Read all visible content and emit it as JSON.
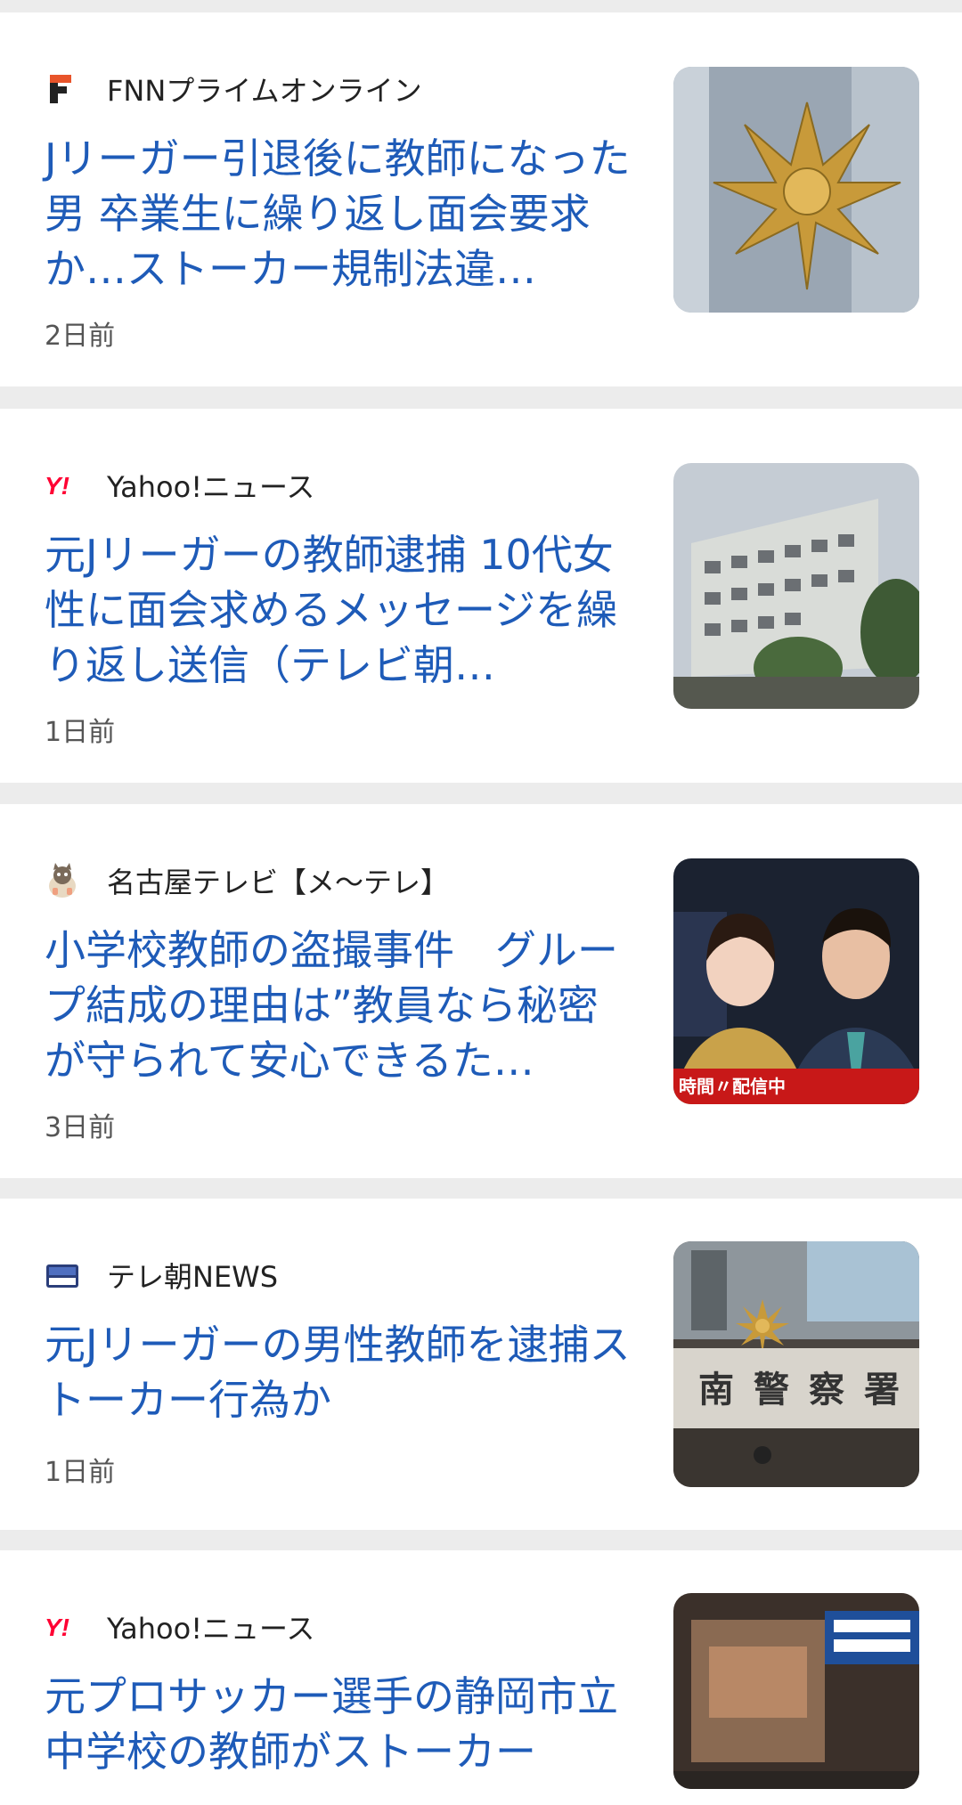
{
  "articles": [
    {
      "source": "FNNプライムオンライン",
      "source_icon": "fnn-logo-icon",
      "title": "Jリーガー引退後に教師になった男 卒業生に繰り返し面会要求か…ストーカー規制法違…",
      "time": "2日前",
      "thumbnail": "police-emblem-thumbnail"
    },
    {
      "source": "Yahoo!ニュース",
      "source_icon": "yahoo-logo-icon",
      "title": "元Jリーガーの教師逮捕 10代女性に面会求めるメッセージを繰り返し送信（テレビ朝…",
      "time": "1日前",
      "thumbnail": "police-building-thumbnail"
    },
    {
      "source": "名古屋テレビ【メ〜テレ】",
      "source_icon": "meitele-mascot-icon",
      "title": "小学校教師の盗撮事件　グループ結成の理由は”教員なら秘密が守られて安心できるた…",
      "time": "3日前",
      "thumbnail": "news-anchors-thumbnail",
      "thumbnail_caption": "時間〃配信中"
    },
    {
      "source": "テレ朝NEWS",
      "source_icon": "tvasahi-news-logo-icon",
      "title": "元Jリーガーの男性教師を逮捕ストーカー行為か",
      "time": "1日前",
      "thumbnail": "police-station-thumbnail",
      "thumbnail_caption": "南警察署"
    },
    {
      "source": "Yahoo!ニュース",
      "source_icon": "yahoo-logo-icon",
      "title": "元プロサッカー選手の静岡市立中学校の教師がストーカー",
      "time": "",
      "thumbnail": "school-night-thumbnail"
    }
  ],
  "colors": {
    "headline": "#1e5bb8",
    "divider": "#ececec",
    "source_text": "#222222",
    "time_text": "#555555"
  }
}
